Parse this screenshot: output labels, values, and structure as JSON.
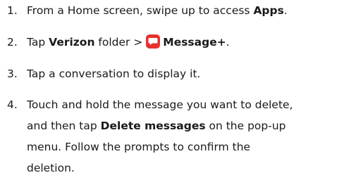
{
  "steps": [
    {
      "number": "1.",
      "parts": {
        "a": "From a Home screen, swipe up to access ",
        "b": "Apps",
        "c": "."
      }
    },
    {
      "number": "2.",
      "parts": {
        "a": "Tap ",
        "b": "Verizon",
        "c": " folder > ",
        "d": "Message+",
        "e": "."
      },
      "icon": "message-plus-icon",
      "icon_color": "#e8312f"
    },
    {
      "number": "3.",
      "parts": {
        "a": "Tap a conversation to display it."
      }
    },
    {
      "number": "4.",
      "lines": {
        "l1": "Touch and hold the message you want to delete,",
        "l2a": "and then tap ",
        "l2b": "Delete messages",
        "l2c": " on the pop-up",
        "l3": "menu. Follow the prompts to confirm the",
        "l4": "deletion."
      }
    }
  ]
}
